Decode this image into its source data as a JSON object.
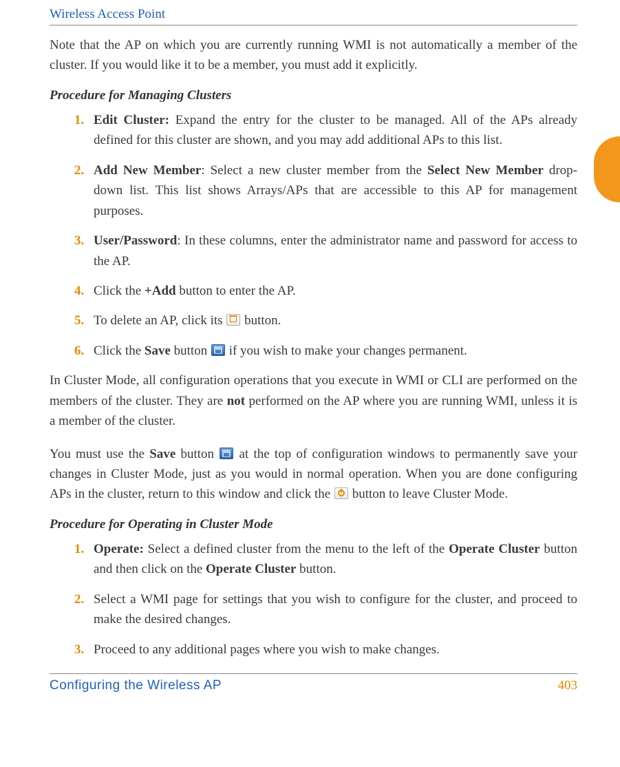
{
  "header": {
    "running_title": "Wireless Access Point"
  },
  "intro": "Note that the AP on which you are currently running WMI is not automatically a member of the cluster. If you would like it to be a member, you must add it explicitly.",
  "sectionA": {
    "heading": "Procedure for Managing Clusters",
    "items": {
      "n1": "1.",
      "l1a": "Edit Cluster:",
      "l1b": " Expand the entry for the cluster to be managed. All of the APs already defined for this cluster are shown, and you may add additional APs to this list.",
      "n2": "2.",
      "l2a": "Add New Member",
      "l2b": ": Select a new cluster member from the ",
      "l2c": "Select New Member",
      "l2d": " drop-down list. This list shows Arrays/APs that are accessible to this AP for management purposes.",
      "n3": "3.",
      "l3a": "User/Password",
      "l3b": ": In these columns, enter the administrator name and password for access to the AP.",
      "n4": "4.",
      "l4a": "Click the ",
      "l4b": "+Add",
      "l4c": " button to enter the AP.",
      "n5": "5.",
      "l5a": "To delete an AP, click its ",
      "l5b": " button.",
      "n6": "6.",
      "l6a": "Click the ",
      "l6b": "Save",
      "l6c": " button ",
      "l6d": " if you wish to make your changes permanent."
    }
  },
  "para2a": "In Cluster Mode, all configuration operations that you execute in WMI or CLI are performed on the members of the cluster. They are ",
  "para2b": "not",
  "para2c": " performed on the AP where you are running WMI, unless it is a member of the cluster.",
  "para3a": "You must use the ",
  "para3b": "Save",
  "para3c": " button ",
  "para3d": " at the top of configuration windows to permanently save your changes in Cluster Mode, just as you would in normal operation. When you are done configuring APs in the cluster, return to this window and click the ",
  "para3e": " button to leave Cluster Mode.",
  "sectionB": {
    "heading": "Procedure for Operating in Cluster Mode",
    "items": {
      "n1": "1.",
      "l1a": "Operate:",
      "l1b": " Select a defined cluster from the menu to the left of the ",
      "l1c": "Operate Cluster",
      "l1d": " button and then click on the ",
      "l1e": "Operate Cluster",
      "l1f": " button.",
      "n2": "2.",
      "l2": "Select a WMI page for settings that you wish to configure for the cluster, and proceed to make the desired changes.",
      "n3": "3.",
      "l3": "Proceed to any additional pages where you wish to make changes."
    }
  },
  "footer": {
    "left": "Configuring the Wireless AP",
    "right": "403"
  }
}
